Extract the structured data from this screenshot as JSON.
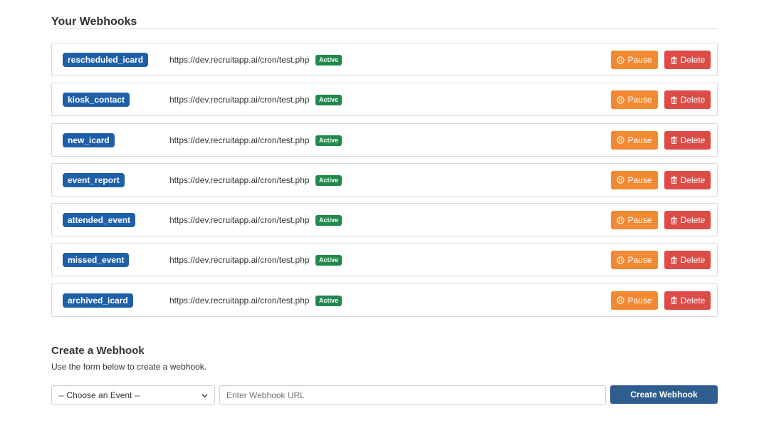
{
  "webhooks_section": {
    "title": "Your Webhooks"
  },
  "webhooks": [
    {
      "event": "rescheduled_icard",
      "url": "https://dev.recruitapp.ai/cron/test.php",
      "status": "Active",
      "pause_label": "Pause",
      "delete_label": "Delete"
    },
    {
      "event": "kiosk_contact",
      "url": "https://dev.recruitapp.ai/cron/test.php",
      "status": "Active",
      "pause_label": "Pause",
      "delete_label": "Delete"
    },
    {
      "event": "new_icard",
      "url": "https://dev.recruitapp.ai/cron/test.php",
      "status": "Active",
      "pause_label": "Pause",
      "delete_label": "Delete"
    },
    {
      "event": "event_report",
      "url": "https://dev.recruitapp.ai/cron/test.php",
      "status": "Active",
      "pause_label": "Pause",
      "delete_label": "Delete"
    },
    {
      "event": "attended_event",
      "url": "https://dev.recruitapp.ai/cron/test.php",
      "status": "Active",
      "pause_label": "Pause",
      "delete_label": "Delete"
    },
    {
      "event": "missed_event",
      "url": "https://dev.recruitapp.ai/cron/test.php",
      "status": "Active",
      "pause_label": "Pause",
      "delete_label": "Delete"
    },
    {
      "event": "archived_icard",
      "url": "https://dev.recruitapp.ai/cron/test.php",
      "status": "Active",
      "pause_label": "Pause",
      "delete_label": "Delete"
    }
  ],
  "create_section": {
    "title": "Create a Webhook",
    "description": "Use the form below to create a webhook.",
    "select_value": "-- Choose an Event --",
    "url_placeholder": "Enter Webhook URL",
    "url_value": "",
    "submit_label": "Create Webhook"
  },
  "icons": {
    "pause": "pause-circle-icon",
    "delete": "trash-icon",
    "select": "chevron-down-icon"
  },
  "colors": {
    "event_badge": "#1f5fa8",
    "status_active": "#1e8a4c",
    "pause": "#f28a33",
    "delete": "#dc4c47",
    "create": "#2f5d8f"
  }
}
